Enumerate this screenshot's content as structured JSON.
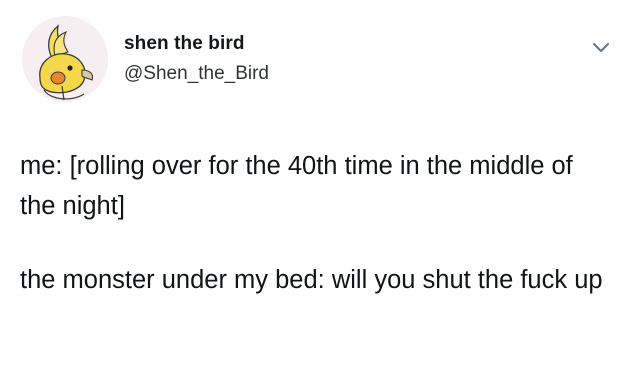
{
  "author": {
    "display_name": "shen the bird",
    "handle": "@Shen_the_Bird"
  },
  "menu": {
    "icon": "chevron-down-icon"
  },
  "tweet": {
    "paragraphs": [
      "me: [rolling over for the 40th time in the middle of the night]",
      "the monster under my bed: will you shut the fuck up"
    ]
  },
  "colors": {
    "text": "#14171a",
    "secondary_text": "#2f3337",
    "avatar_bg": "#f6eef0",
    "bird_yellow": "#f2d84a",
    "bird_cheek": "#e8852c"
  }
}
